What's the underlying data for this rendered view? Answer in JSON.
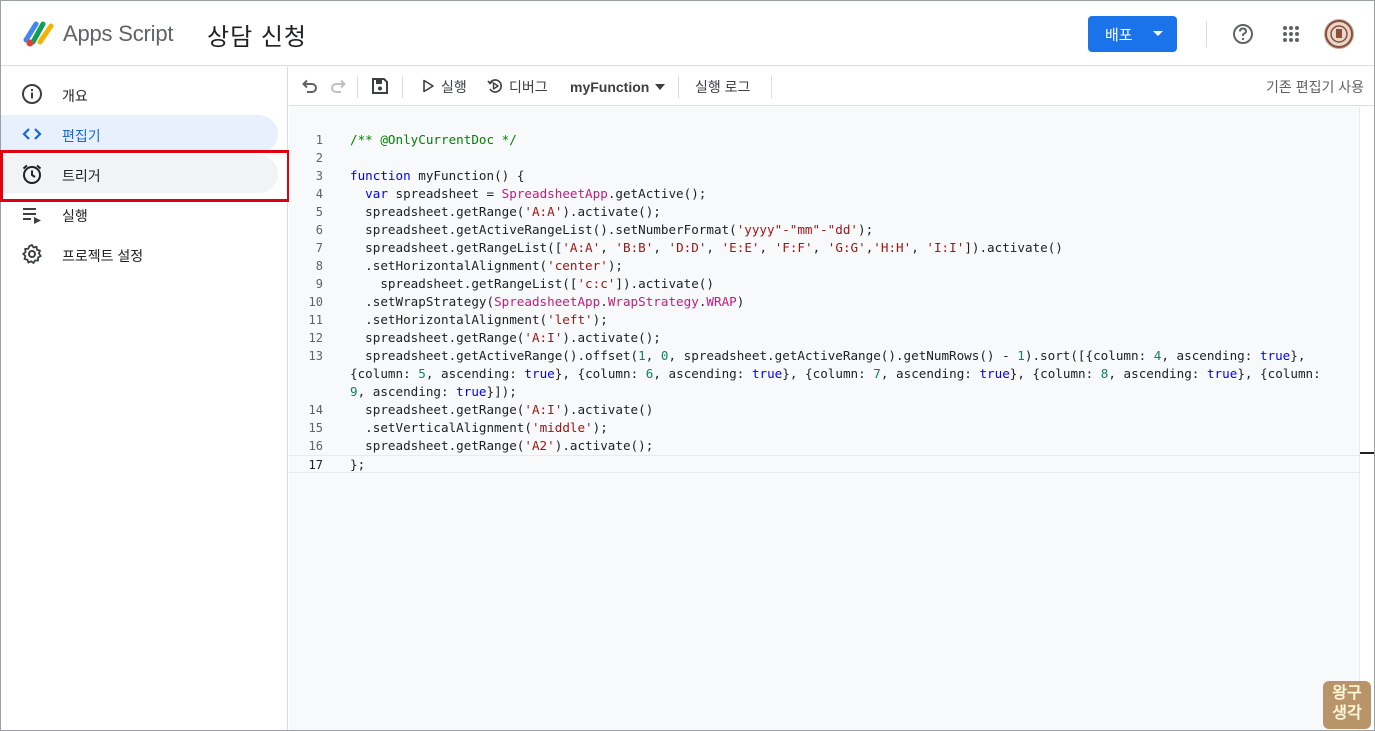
{
  "header": {
    "app_name": "Apps Script",
    "project_title": "상담 신청",
    "deploy_label": "배포",
    "icons": [
      "apps-script-logo-icon",
      "help-icon",
      "apps-grid-icon",
      "avatar"
    ]
  },
  "sidebar": {
    "items": [
      {
        "label": "개요",
        "icon": "info-icon"
      },
      {
        "label": "편집기",
        "icon": "code-icon",
        "active": true
      },
      {
        "label": "트리거",
        "icon": "alarm-clock-icon",
        "highlighted": true
      },
      {
        "label": "실행",
        "icon": "executions-list-icon"
      },
      {
        "label": "프로젝트 설정",
        "icon": "gear-icon"
      }
    ]
  },
  "toolbar": {
    "run_label": "실행",
    "debug_label": "디버그",
    "function_select": "myFunction",
    "log_label": "실행 로그",
    "legacy_label": "기존 편집기 사용"
  },
  "editor": {
    "lines": [
      {
        "n": "1",
        "html": "<span class=\"cm\">/** @OnlyCurrentDoc */</span>"
      },
      {
        "n": "2",
        "html": ""
      },
      {
        "n": "3",
        "html": "<span class=\"kw\">function</span> myFunction() {"
      },
      {
        "n": "4",
        "html": "  <span class=\"kw\">var</span> spreadsheet = <span class=\"cls\">SpreadsheetApp</span>.getActive();"
      },
      {
        "n": "5",
        "html": "  spreadsheet.getRange(<span class=\"st\">'A:A'</span>).activate();"
      },
      {
        "n": "6",
        "html": "  spreadsheet.getActiveRangeList().setNumberFormat(<span class=\"st\">'yyyy\"-\"mm\"-\"dd'</span>);"
      },
      {
        "n": "7",
        "html": "  spreadsheet.getRangeList([<span class=\"st\">'A:A'</span>, <span class=\"st\">'B:B'</span>, <span class=\"st\">'D:D'</span>, <span class=\"st\">'E:E'</span>, <span class=\"st\">'F:F'</span>, <span class=\"st\">'G:G'</span>,<span class=\"st\">'H:H'</span>, <span class=\"st\">'I:I'</span>]).activate()"
      },
      {
        "n": "8",
        "html": "  .setHorizontalAlignment(<span class=\"st\">'center'</span>);"
      },
      {
        "n": "9",
        "html": "    spreadsheet.getRangeList([<span class=\"st\">'c:c'</span>]).activate()"
      },
      {
        "n": "10",
        "html": "  .setWrapStrategy(<span class=\"cls\">SpreadsheetApp</span>.<span class=\"cls\">WrapStrategy</span>.<span class=\"cls\">WRAP</span>)"
      },
      {
        "n": "11",
        "html": "  .setHorizontalAlignment(<span class=\"st\">'left'</span>);"
      },
      {
        "n": "12",
        "html": "  spreadsheet.getRange(<span class=\"st\">'A:I'</span>).activate();"
      },
      {
        "n": "13",
        "html": "  spreadsheet.getActiveRange().offset(<span class=\"num\">1</span>, <span class=\"num\">0</span>, spreadsheet.getActiveRange().getNumRows() - <span class=\"num\">1</span>).sort([{column: <span class=\"num\">4</span>, ascending: <span class=\"bool\">true</span>},"
      },
      {
        "n": "",
        "html": "{column: <span class=\"num\">5</span>, ascending: <span class=\"bool\">true</span>}, {column: <span class=\"num\">6</span>, ascending: <span class=\"bool\">true</span>}, {column: <span class=\"num\">7</span>, ascending: <span class=\"bool\">true</span>}, {column: <span class=\"num\">8</span>, ascending: <span class=\"bool\">true</span>}, {column:"
      },
      {
        "n": "",
        "html": "<span class=\"num\">9</span>, ascending: <span class=\"bool\">true</span>}]);"
      },
      {
        "n": "14",
        "html": "  spreadsheet.getRange(<span class=\"st\">'A:I'</span>).activate()"
      },
      {
        "n": "15",
        "html": "  .setVerticalAlignment(<span class=\"st\">'middle'</span>);"
      },
      {
        "n": "16",
        "html": "  spreadsheet.getRange(<span class=\"st\">'A2'</span>).activate();"
      },
      {
        "n": "17",
        "html": "};",
        "current": true
      }
    ]
  },
  "watermark": {
    "line1": "왕구",
    "line2": "생각"
  },
  "colors": {
    "accent": "#1a73e8",
    "active_nav_bg": "#e8f0fe",
    "highlight_border": "#e0000f"
  }
}
